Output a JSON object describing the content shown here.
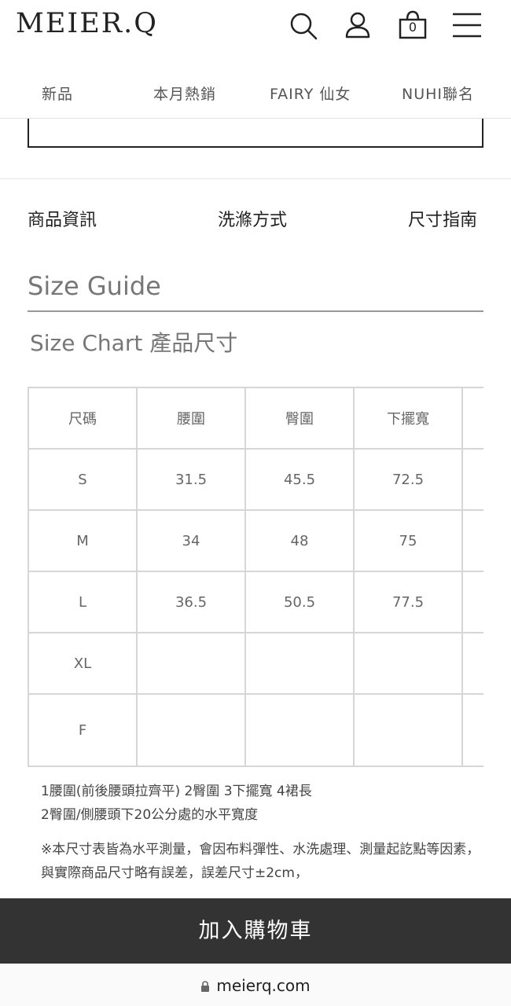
{
  "brand": {
    "logo": "MEIER.Q"
  },
  "header": {
    "cart_count": "0",
    "icons": [
      "search-icon",
      "user-icon",
      "bag-icon",
      "menu-icon"
    ]
  },
  "nav": {
    "items": [
      {
        "label": "新品"
      },
      {
        "label": "本月熱銷"
      },
      {
        "label": "FAIRY 仙女"
      },
      {
        "label": "NUHI聯名"
      }
    ]
  },
  "tabs": [
    {
      "label": "商品資訊"
    },
    {
      "label": "洗滌方式"
    },
    {
      "label": "尺寸指南"
    }
  ],
  "size_guide": {
    "title": "Size Guide",
    "chart_title": "Size Chart 產品尺寸",
    "table": {
      "headers": [
        "尺碼",
        "腰圍",
        "臀圍",
        "下擺寬",
        ""
      ],
      "rows": [
        [
          "S",
          "31.5",
          "45.5",
          "72.5",
          ""
        ],
        [
          "M",
          "34",
          "48",
          "75",
          ""
        ],
        [
          "L",
          "36.5",
          "50.5",
          "77.5",
          ""
        ],
        [
          "XL",
          "",
          "",
          "",
          ""
        ],
        [
          "F",
          "",
          "",
          "",
          ""
        ]
      ]
    },
    "notes": [
      "1腰圍(前後腰頭拉齊平) 2臀圍 3下擺寬 4裙長",
      "2臀圍/側腰頭下20公分處的水平寬度",
      "※本尺寸表皆為水平測量，會因布料彈性、水洗處理、測量起訖點等因素，",
      "與實際商品尺寸略有誤差，誤差尺寸±2cm，"
    ]
  },
  "cart_button": {
    "label": "加入購物車"
  },
  "browser": {
    "url": "meierq.com"
  },
  "colors": {
    "cart_bar": "#333333",
    "table_border": "#d6d6d6",
    "guide_text": "#777777"
  }
}
